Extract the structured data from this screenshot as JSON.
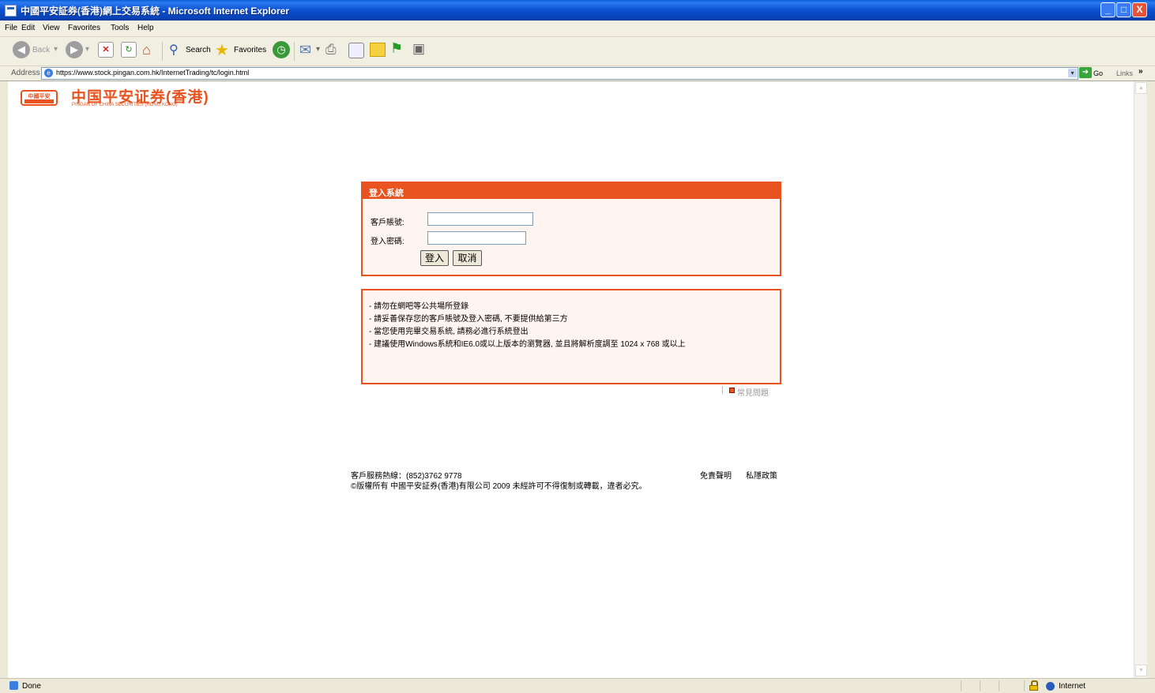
{
  "window": {
    "title": "中國平安証券(香港)網上交易系統 - Microsoft Internet Explorer",
    "controls": {
      "minimize": "_",
      "maximize": "□",
      "close": "X"
    }
  },
  "menu": [
    "File",
    "Edit",
    "View",
    "Favorites",
    "Tools",
    "Help"
  ],
  "toolbar": {
    "back": "Back",
    "search": "Search",
    "favorites": "Favorites"
  },
  "address": {
    "label": "Address",
    "url": "https://www.stock.pingan.com.hk/InternetTrading/tc/login.html",
    "go": "Go",
    "links": "Links"
  },
  "logo": {
    "badge": "中國平安",
    "name": "中国平安证券(香港)",
    "sub": "PINGAN OF CHINA SECURITIES (HONG KONG)"
  },
  "login": {
    "title": "登入系統",
    "account_label": "客戶賬號:",
    "account_value": "",
    "password_label": "登入密碼:",
    "password_value": "",
    "login_button": "登入",
    "cancel_button": "取消"
  },
  "notices": [
    "- 請勿在網吧等公共場所登錄",
    "- 請妥善保存您的客戶賬號及登入密碼, 不要提供給第三方",
    "- 當您使用完畢交易系統, 請務必進行系統登出",
    "- 建議使用Windows系統和IE6.0或以上版本的瀏覽器, 並且將解析度調至 1024 x 768 或以上"
  ],
  "faq": "常見問題",
  "footer": {
    "hotline": "客戶服務熱線：(852)3762 9778",
    "copyright": "©版權所有 中國平安証券(香港)有限公司 2009 未經許可不得復制或轉載，違者必究。",
    "disclaimer": "免責聲明",
    "privacy": "私隱政策"
  },
  "status": {
    "text": "Done",
    "zone": "Internet"
  },
  "colors": {
    "accent": "#e8531f",
    "panel_bg": "#fff5f0",
    "titlebar": "#0a50cf"
  }
}
